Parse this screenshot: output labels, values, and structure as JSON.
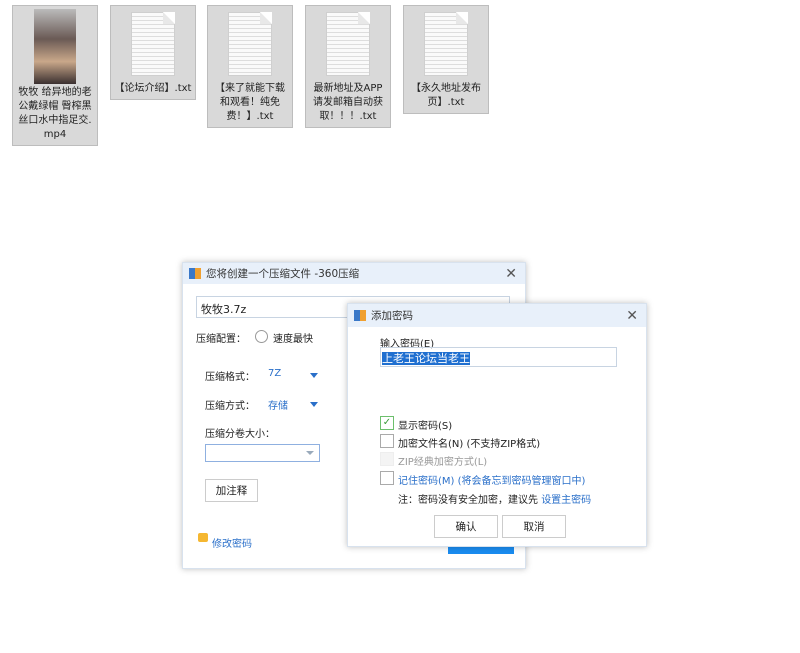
{
  "files": [
    {
      "name": "牧牧 给异地的老公戴绿帽 臀榨黑丝口水中指足交.mp4",
      "type": "video"
    },
    {
      "name": "【论坛介绍】.txt",
      "type": "text"
    },
    {
      "name": "【来了就能下载和观看！纯免费！】.txt",
      "type": "text"
    },
    {
      "name": "最新地址及APP请发邮箱自动获取！！！.txt",
      "type": "text"
    },
    {
      "name": "【永久地址发布页】.txt",
      "type": "text"
    }
  ],
  "main_dialog": {
    "title": "您将创建一个压缩文件 -360压缩",
    "filename": "牧牧3.7z",
    "config_label": "压缩配置：",
    "config_option": "速度最快",
    "format_label": "压缩格式：",
    "format_value": "7Z",
    "method_label": "压缩方式：",
    "method_value": "存储",
    "volume_label": "压缩分卷大小：",
    "volume_value": "",
    "comment_button": "加注释",
    "change_password": "修改密码"
  },
  "password_dialog": {
    "title": "添加密码",
    "input_label": "输入密码(E)",
    "password": "上老王论坛当老王",
    "show_password": {
      "label": "显示密码(S)",
      "checked": true
    },
    "encrypt_filenames": {
      "label": "加密文件名(N) (不支持ZIP格式)",
      "checked": false
    },
    "zip_classic": {
      "label": "ZIP经典加密方式(L)",
      "checked": false,
      "disabled": true
    },
    "remember": {
      "label": "记住密码(M) (将会备忘到密码管理窗口中)",
      "checked": false
    },
    "note": "注：密码没有安全加密，建议先 ",
    "note_link": "设置主密码",
    "ok": "确认",
    "cancel": "取消"
  }
}
